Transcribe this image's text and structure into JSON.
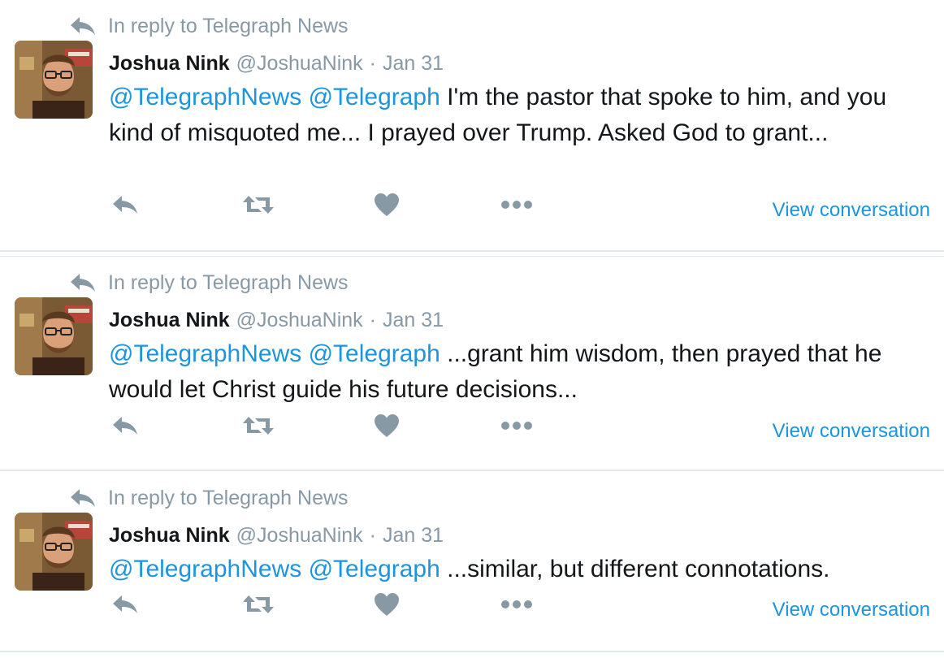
{
  "colors": {
    "muted": "#8899a6",
    "link": "#1b95e0",
    "text": "#14171a",
    "divider": "#e1e8ed"
  },
  "tweets": [
    {
      "reply_context": "In reply to Telegraph News",
      "fullname": "Joshua Nink",
      "screen_name": "@JoshuaNink",
      "separator": "·",
      "date": "Jan 31",
      "mention_1": "@TelegraphNews",
      "mention_2": "@Telegraph",
      "body": " I'm the pastor that spoke to him,  and you kind of misquoted me... I prayed over Trump. Asked God to grant...",
      "view_conversation": "View conversation",
      "icons": [
        "reply-icon",
        "retweet-icon",
        "like-icon",
        "more-icon"
      ]
    },
    {
      "reply_context": "In reply to Telegraph News",
      "fullname": "Joshua Nink",
      "screen_name": "@JoshuaNink",
      "separator": "·",
      "date": "Jan 31",
      "mention_1": "@TelegraphNews",
      "mention_2": "@Telegraph",
      "body": " ...grant him wisdom, then prayed that he would let Christ guide his future decisions...",
      "view_conversation": "View conversation",
      "icons": [
        "reply-icon",
        "retweet-icon",
        "like-icon",
        "more-icon"
      ]
    },
    {
      "reply_context": "In reply to Telegraph News",
      "fullname": "Joshua Nink",
      "screen_name": "@JoshuaNink",
      "separator": "·",
      "date": "Jan 31",
      "mention_1": "@TelegraphNews",
      "mention_2": "@Telegraph",
      "body": " ...similar, but different connotations.",
      "view_conversation": "View conversation",
      "icons": [
        "reply-icon",
        "retweet-icon",
        "like-icon",
        "more-icon"
      ]
    }
  ]
}
